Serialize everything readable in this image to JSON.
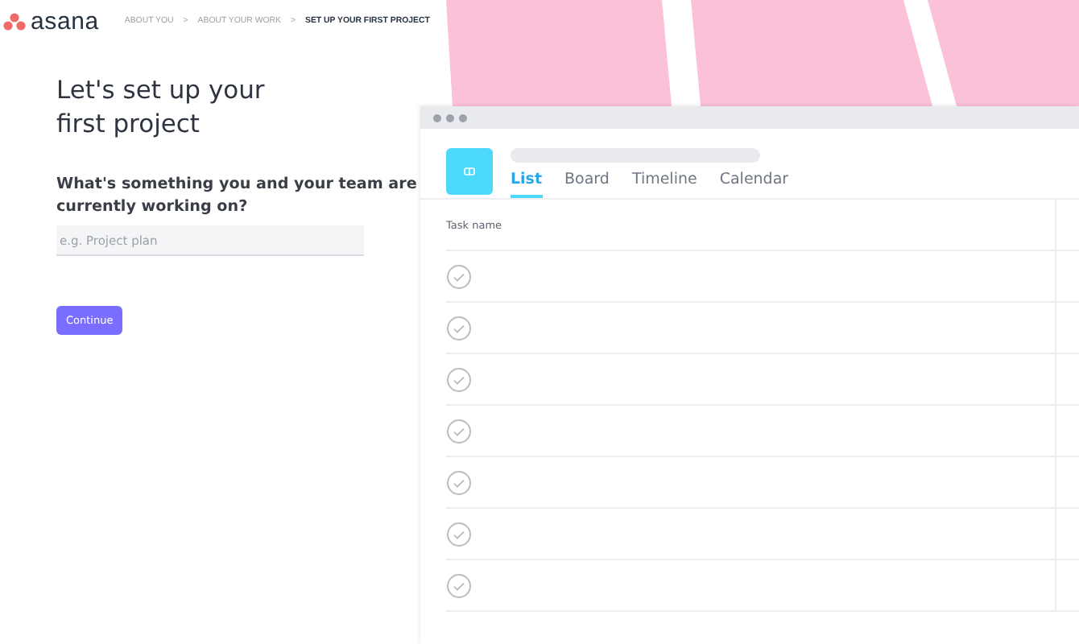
{
  "header": {
    "logo": "asana",
    "breadcrumbs": [
      {
        "label": "ABOUT YOU",
        "selected": false
      },
      {
        "label": "ABOUT YOUR WORK",
        "selected": false
      },
      {
        "label": "SET UP YOUR FIRST PROJECT",
        "selected": true
      }
    ],
    "separator": ">"
  },
  "setup": {
    "title": "Let's set up your first project",
    "question": "What's something you and your team are currently working on?",
    "input": {
      "placeholder": "e.g. Project plan"
    },
    "button": "Continue"
  },
  "preview": {
    "tabs": [
      {
        "label": "List",
        "selected": true
      },
      {
        "label": "Board",
        "selected": false
      },
      {
        "label": "Timeline",
        "selected": false
      },
      {
        "label": "Calendar",
        "selected": false
      }
    ],
    "column": "Task name",
    "tasks": [
      {
        "completed": false
      },
      {
        "completed": false
      },
      {
        "completed": false
      },
      {
        "completed": false
      },
      {
        "completed": false
      },
      {
        "completed": false
      },
      {
        "completed": false
      }
    ]
  }
}
